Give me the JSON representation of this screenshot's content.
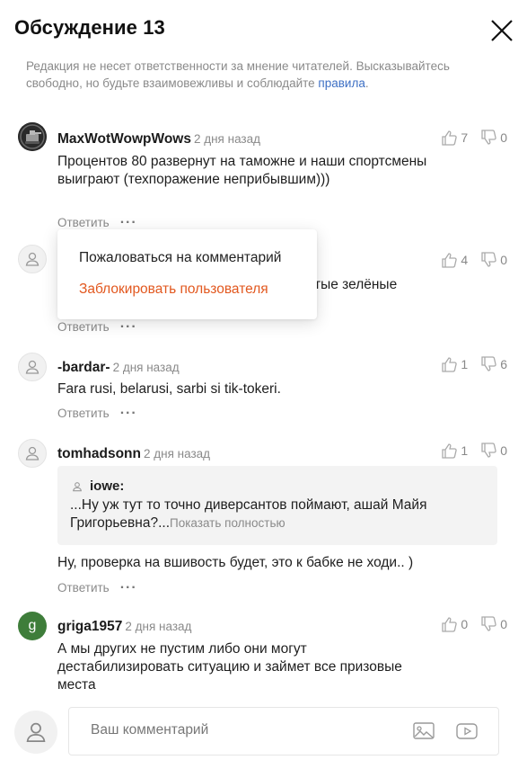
{
  "header": {
    "title": "Обсуждение 13"
  },
  "notice": {
    "text": "Редакция не несет ответственности за мнение читателей. Высказывайтесь свободно, но будьте взаимовежливы и соблюдайте ",
    "link": "правила",
    "end": "."
  },
  "actions": {
    "reply": "Ответить",
    "more": "···"
  },
  "comments": [
    {
      "author": "MaxWotWowpWows",
      "time": "2 дня назад",
      "likes": "7",
      "dislikes": "0",
      "text": "Процентов 80 развернут на таможне и наши спортсмены выиграют (техпоражение неприбывшим)))"
    },
    {
      "author": "",
      "time": "",
      "likes": "4",
      "dislikes": "0",
      "text": "тые зелёные"
    },
    {
      "author": "-bardar-",
      "time": "2 дня назад",
      "likes": "1",
      "dislikes": "6",
      "text": "Fara rusi, belarusi, sarbi si tik-tokeri."
    },
    {
      "author": "tomhadsonn",
      "time": "2 дня назад",
      "likes": "1",
      "dislikes": "0",
      "quote": {
        "author": "iowe:",
        "text": "...Ну уж тут то точно диверсантов поймают, ашай Майя Григорьевна?...",
        "more": "Показать полностью"
      },
      "text": "Ну, проверка на вшивость будет, это к бабке не ходи.. )"
    },
    {
      "author": "griga1957",
      "avatar_letter": "g",
      "time": "2 дня назад",
      "likes": "0",
      "dislikes": "0",
      "text": "А мы других не пустим либо они могут дестабилизировать ситуацию и займет все призовые места"
    }
  ],
  "menu": {
    "report": "Пожаловаться на комментарий",
    "block": "Заблокировать пользователя"
  },
  "composer": {
    "placeholder": "Ваш комментарий"
  },
  "colors": {
    "accent": "#e2581f",
    "link": "#3d6fc4",
    "avatar_green": "#3e7d3a"
  }
}
